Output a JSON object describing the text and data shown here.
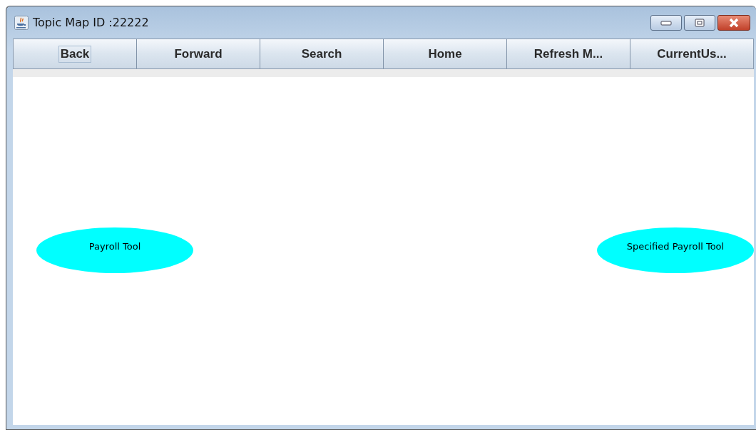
{
  "window": {
    "title": "Topic Map ID :22222"
  },
  "toolbar": [
    {
      "label": "Back",
      "focused": true
    },
    {
      "label": "Forward",
      "focused": false
    },
    {
      "label": "Search",
      "focused": false
    },
    {
      "label": "Home",
      "focused": false
    },
    {
      "label": "Refresh M...",
      "focused": false
    },
    {
      "label": "CurrentUs...",
      "focused": false
    }
  ],
  "nodes": [
    {
      "label": "Payroll Tool",
      "color": "#00ffff"
    },
    {
      "label": "Specified Payroll Tool",
      "color": "#00ffff"
    }
  ]
}
